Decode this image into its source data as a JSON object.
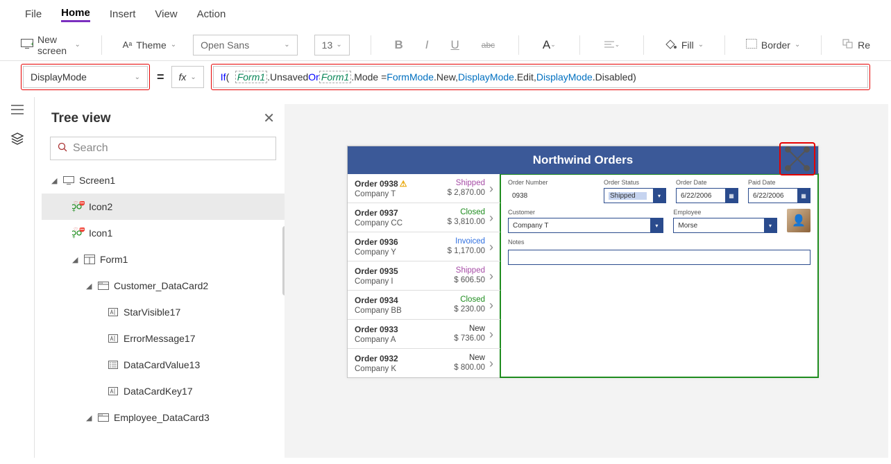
{
  "menu": {
    "file": "File",
    "home": "Home",
    "insert": "Insert",
    "view": "View",
    "action": "Action"
  },
  "ribbon": {
    "new_screen": "New screen",
    "theme": "Theme",
    "font_name": "Open Sans",
    "font_size": "13",
    "fill": "Fill",
    "border": "Border",
    "re": "Re"
  },
  "fbar": {
    "property": "DisplayMode",
    "fx": "fx",
    "formula": {
      "if": "If",
      "lp": "(",
      "ref1": "Form1",
      "dot1": ".Unsaved ",
      "or": "Or",
      "sp": " ",
      "ref2": "Form1",
      "dot2": ".Mode = ",
      "type1": "FormMode",
      "dot3": ".New, ",
      "type2": "DisplayMode",
      "dot4": ".Edit, ",
      "type3": "DisplayMode",
      "dot5": ".Disabled ",
      "rp": ")"
    }
  },
  "tree": {
    "title": "Tree view",
    "search_ph": "Search",
    "nodes": {
      "screen1": "Screen1",
      "icon2": "Icon2",
      "icon1": "Icon1",
      "form1": "Form1",
      "cust_card": "Customer_DataCard2",
      "starvis": "StarVisible17",
      "errmsg": "ErrorMessage17",
      "dcval": "DataCardValue13",
      "dckey": "DataCardKey17",
      "emp_card": "Employee_DataCard3"
    }
  },
  "app": {
    "title": "Northwind Orders",
    "orders": [
      {
        "n": "Order 0938",
        "c": "Company T",
        "s": "Shipped",
        "sc": "st-shipped",
        "a": "$ 2,870.00",
        "warn": true
      },
      {
        "n": "Order 0937",
        "c": "Company CC",
        "s": "Closed",
        "sc": "st-closed",
        "a": "$ 3,810.00"
      },
      {
        "n": "Order 0936",
        "c": "Company Y",
        "s": "Invoiced",
        "sc": "st-invoiced",
        "a": "$ 1,170.00"
      },
      {
        "n": "Order 0935",
        "c": "Company I",
        "s": "Shipped",
        "sc": "st-shipped",
        "a": "$ 606.50"
      },
      {
        "n": "Order 0934",
        "c": "Company BB",
        "s": "Closed",
        "sc": "st-closed",
        "a": "$ 230.00"
      },
      {
        "n": "Order 0933",
        "c": "Company A",
        "s": "New",
        "sc": "st-new",
        "a": "$ 736.00"
      },
      {
        "n": "Order 0932",
        "c": "Company K",
        "s": "New",
        "sc": "st-new",
        "a": "$ 800.00"
      }
    ],
    "form": {
      "order_number_lab": "Order Number",
      "order_number": "0938",
      "order_status_lab": "Order Status",
      "order_status": "Shipped",
      "order_date_lab": "Order Date",
      "order_date": "6/22/2006",
      "paid_date_lab": "Paid Date",
      "paid_date": "6/22/2006",
      "customer_lab": "Customer",
      "customer": "Company T",
      "employee_lab": "Employee",
      "employee": "Morse",
      "notes_lab": "Notes"
    }
  }
}
